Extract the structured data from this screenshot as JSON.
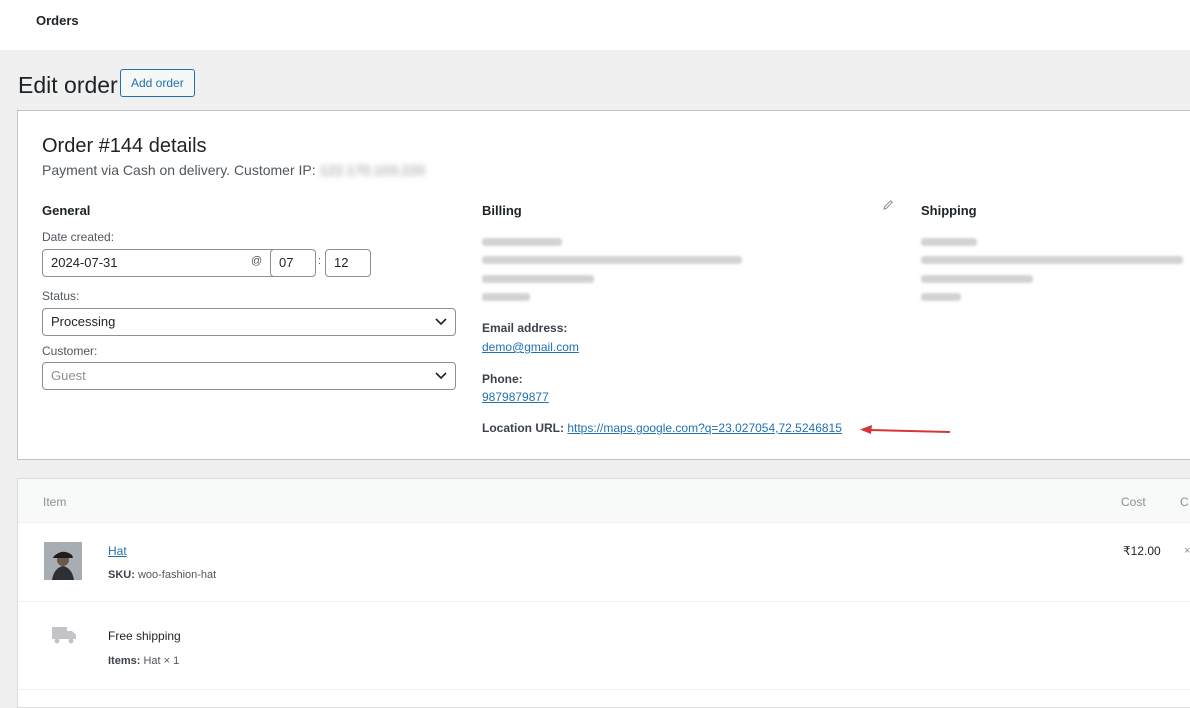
{
  "topbar": {
    "title": "Orders"
  },
  "page": {
    "title": "Edit order",
    "add_button": "Add order"
  },
  "order": {
    "heading": "Order #144 details",
    "payment_text": "Payment via Cash on delivery. Customer IP:",
    "customer_ip": "122.170.103.220"
  },
  "general": {
    "heading": "General",
    "date_label": "Date created:",
    "date_value": "2024-07-31",
    "at_sign": "@",
    "hour": "07",
    "colon": ":",
    "minute": "12",
    "status_label": "Status:",
    "status_value": "Processing",
    "customer_label": "Customer:",
    "customer_value": "Guest"
  },
  "billing": {
    "heading": "Billing",
    "email_label": "Email address:",
    "email_value": "demo@gmail.com",
    "phone_label": "Phone:",
    "phone_value": "9879879877",
    "location_label": "Location URL:",
    "location_value": "https://maps.google.com?q=23.027054,72.5246815"
  },
  "shipping": {
    "heading": "Shipping"
  },
  "items": {
    "col_item": "Item",
    "col_cost": "Cost",
    "col_c": "C",
    "products": [
      {
        "name": "Hat",
        "sku_label": "SKU:",
        "sku_value": "woo-fashion-hat",
        "cost": "₹12.00",
        "x": "×"
      }
    ],
    "shipping_line": {
      "name": "Free shipping",
      "items_label": "Items:",
      "items_value": "Hat × 1"
    }
  },
  "colors": {
    "accent": "#2271b1",
    "arrow": "#d63638"
  },
  "icons": [
    "pencil-icon",
    "chevron-down-icon",
    "truck-icon",
    "arrow-icon"
  ]
}
